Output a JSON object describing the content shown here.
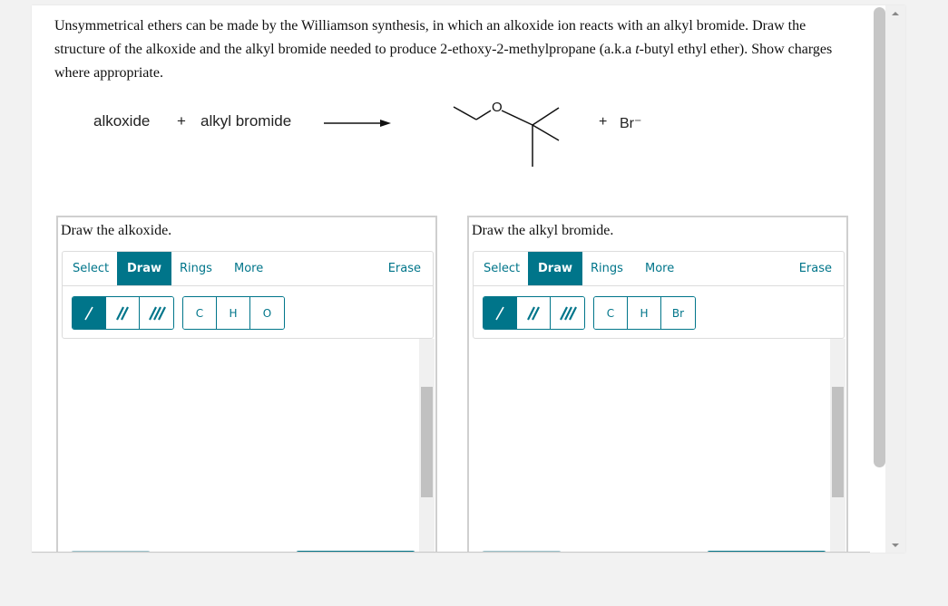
{
  "question": {
    "part1": "Unsymmetrical ethers can be made by the Williamson synthesis, in which an alkoxide ion reacts with an alkyl bromide. Draw the structure of the alkoxide and the alkyl bromide needed to produce 2-ethoxy-2-methylpropane (a.k.a ",
    "italic": "t",
    "part2": "-butyl ethyl ether). Show charges where appropriate."
  },
  "scheme": {
    "reactant1": "alkoxide",
    "plus1": "+",
    "reactant2": "alkyl bromide",
    "product_atom": "O",
    "plus2": "+",
    "byproduct": "Br⁻"
  },
  "panels": [
    {
      "title": "Draw the alkoxide.",
      "tabs": [
        "Select",
        "Draw",
        "Rings",
        "More"
      ],
      "active_tab": "Draw",
      "erase": "Erase",
      "bonds": [
        "single-bond",
        "double-bond",
        "triple-bond"
      ],
      "atoms": [
        "C",
        "H",
        "O"
      ]
    },
    {
      "title": "Draw the alkyl bromide.",
      "tabs": [
        "Select",
        "Draw",
        "Rings",
        "More"
      ],
      "active_tab": "Draw",
      "erase": "Erase",
      "bonds": [
        "single-bond",
        "double-bond",
        "triple-bond"
      ],
      "atoms": [
        "C",
        "H",
        "Br"
      ]
    }
  ],
  "colors": {
    "accent": "#00758a"
  }
}
